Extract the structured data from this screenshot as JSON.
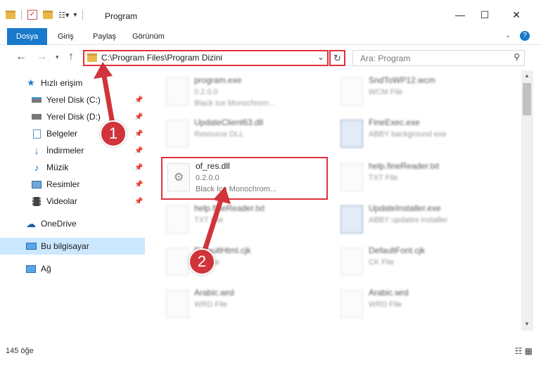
{
  "window": {
    "title": "Program"
  },
  "ribbon": {
    "tabs": [
      "Dosya",
      "Giriş",
      "Paylaş",
      "Görünüm"
    ]
  },
  "address": {
    "path": "C:\\Program Files\\Program Dizini"
  },
  "search": {
    "placeholder": "Ara: Program"
  },
  "sidebar": {
    "items": [
      {
        "label": "Hızlı erişim"
      },
      {
        "label": "Yerel Disk (C:)"
      },
      {
        "label": "Yerel Disk (D:)"
      },
      {
        "label": "Belgeler"
      },
      {
        "label": "İndirmeler"
      },
      {
        "label": "Müzik"
      },
      {
        "label": "Resimler"
      },
      {
        "label": "Videolar"
      },
      {
        "label": "OneDrive"
      },
      {
        "label": "Bu bilgisayar"
      },
      {
        "label": "Ağ"
      }
    ]
  },
  "files": [
    {
      "name": "program.exe",
      "sub1": "0.2.0.0",
      "sub2": "Black Ice Monochrom..."
    },
    {
      "name": "SndToWP12.wcm",
      "sub1": "WCM File",
      "sub2": ""
    },
    {
      "name": "UpdateClient63.dll",
      "sub1": "Resource DLL",
      "sub2": ""
    },
    {
      "name": "FineExec.exe",
      "sub1": "ABBY background exe",
      "sub2": ""
    },
    {
      "name": "of_res.dll",
      "sub1": "0.2.0.0",
      "sub2": "Black Ice Monochrom..."
    },
    {
      "name": "help.fineReader.txt",
      "sub1": "TXT File",
      "sub2": ""
    },
    {
      "name": "help.fineReader.txt",
      "sub1": "TXT File",
      "sub2": ""
    },
    {
      "name": "UpdateInstaller.exe",
      "sub1": "ABBY updates installer",
      "sub2": ""
    },
    {
      "name": "DefaultHtml.cjk",
      "sub1": "CK File",
      "sub2": ""
    },
    {
      "name": "DefaultFont.cjk",
      "sub1": "CK File",
      "sub2": ""
    },
    {
      "name": "Arabic.wrd",
      "sub1": "WRD File",
      "sub2": ""
    },
    {
      "name": "Arabic.wrd",
      "sub1": "WRD File",
      "sub2": ""
    }
  ],
  "status": {
    "count": "145 öğe"
  },
  "annotations": {
    "step1": "1",
    "step2": "2"
  },
  "colors": {
    "accent": "#1979ca",
    "highlight": "#e0323a",
    "selected": "#cce8ff"
  }
}
